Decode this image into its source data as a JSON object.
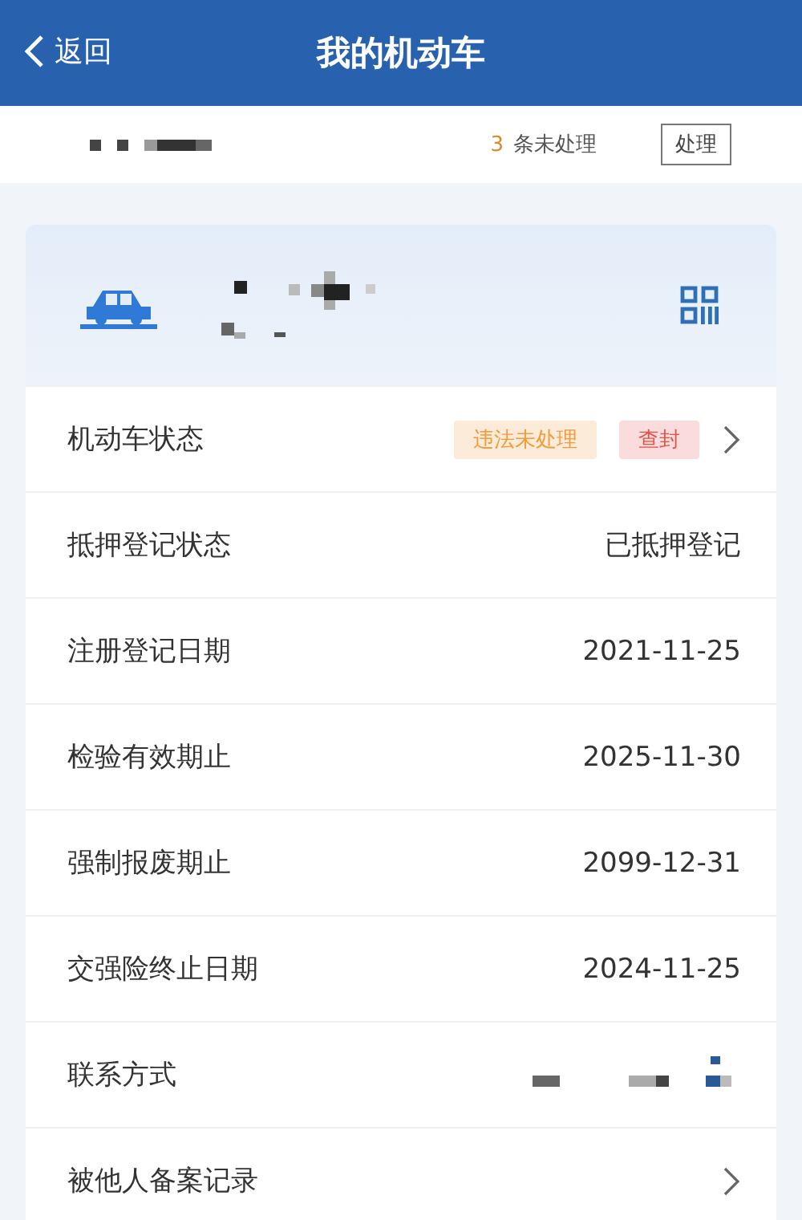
{
  "header": {
    "back": "返回",
    "title": "我的机动车"
  },
  "notice": {
    "count": "3",
    "text": "条未处理",
    "button": "处理"
  },
  "rows": [
    {
      "kind": "tags",
      "label": "机动车状态",
      "tags": [
        {
          "text": "违法未处理",
          "color": "#f29a3c"
        },
        {
          "text": "查封",
          "color": "#e2504a"
        }
      ]
    },
    {
      "kind": "value",
      "label": "抵押登记状态",
      "value": "已抵押登记"
    },
    {
      "kind": "value",
      "label": "注册登记日期",
      "value": "2021-11-25"
    },
    {
      "kind": "value",
      "label": "检验有效期止",
      "value": "2025-11-30"
    },
    {
      "kind": "value",
      "label": "强制报废期止",
      "value": "2099-12-31"
    },
    {
      "kind": "value",
      "label": "交强险终止日期",
      "value": "2024-11-25"
    },
    {
      "kind": "masked",
      "label": "联系方式"
    },
    {
      "kind": "link",
      "label": "被他人备案记录"
    }
  ]
}
